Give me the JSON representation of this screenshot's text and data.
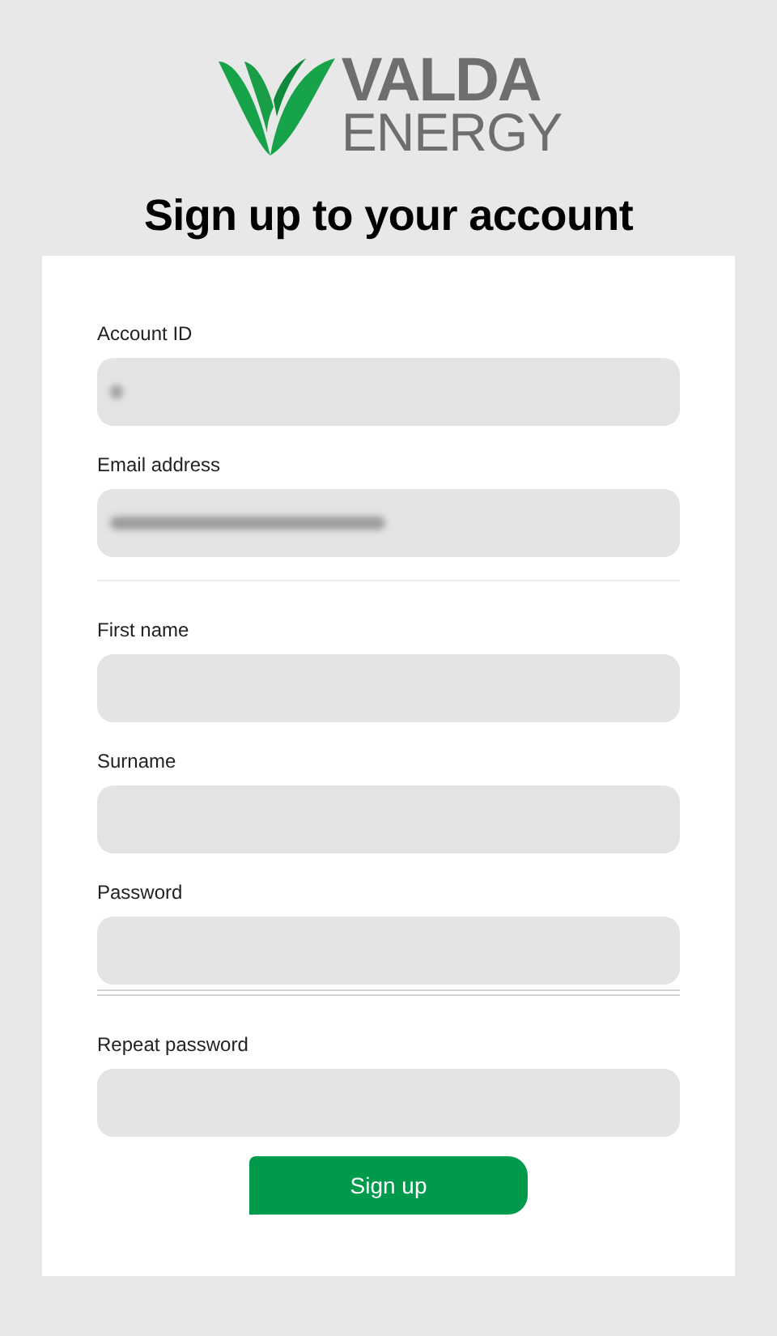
{
  "logo": {
    "line1": "VALDA",
    "line2": "ENERGY"
  },
  "heading": "Sign up to your account",
  "form": [
    {
      "kind": "masked",
      "label": "Account ID"
    },
    {
      "kind": "maskedlong",
      "label": "Email address"
    },
    {
      "kind": "divider"
    },
    {
      "kind": "field",
      "label": "First name"
    },
    {
      "kind": "field",
      "label": "Surname"
    },
    {
      "kind": "field",
      "label": "Password"
    },
    {
      "kind": "double_divider"
    },
    {
      "kind": "field",
      "label": "Repeat password"
    }
  ],
  "submit": "Sign up"
}
